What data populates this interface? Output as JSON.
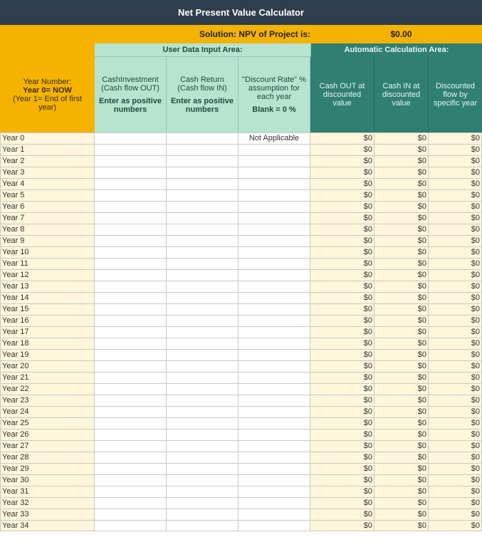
{
  "title": "Net Present Value Calculator",
  "solution": {
    "label": "Solution: NPV of Project is:",
    "value": "$0.00"
  },
  "section_labels": {
    "user": "User Data Input Area:",
    "auto": "Automatic Calculation Area:"
  },
  "headers": {
    "year": {
      "line1": "Year Number:",
      "line2": "Year 0= NOW",
      "line3": "(Year 1= End of first year)"
    },
    "user_cols": [
      {
        "title": "CashInvestment (Cash flow OUT)",
        "sub": "Enter as positive numbers"
      },
      {
        "title": "Cash Return (Cash flow IN)",
        "sub": "Enter as positive numbers"
      },
      {
        "title": "\"Discount Rate\" % assumption for each year",
        "sub": "Blank = 0 %"
      }
    ],
    "auto_cols": [
      "Cash OUT at discounted value",
      "Cash IN at discounted value",
      "Discounted flow by specific year"
    ]
  },
  "rows": [
    {
      "year": "Year 0",
      "inv": "",
      "ret": "",
      "rate": "Not Applicable",
      "out": "$0",
      "in": "$0",
      "flow": "$0"
    },
    {
      "year": "Year 1",
      "inv": "",
      "ret": "",
      "rate": "",
      "out": "$0",
      "in": "$0",
      "flow": "$0"
    },
    {
      "year": "Year 2",
      "inv": "",
      "ret": "",
      "rate": "",
      "out": "$0",
      "in": "$0",
      "flow": "$0"
    },
    {
      "year": "Year 3",
      "inv": "",
      "ret": "",
      "rate": "",
      "out": "$0",
      "in": "$0",
      "flow": "$0"
    },
    {
      "year": "Year 4",
      "inv": "",
      "ret": "",
      "rate": "",
      "out": "$0",
      "in": "$0",
      "flow": "$0"
    },
    {
      "year": "Year 5",
      "inv": "",
      "ret": "",
      "rate": "",
      "out": "$0",
      "in": "$0",
      "flow": "$0"
    },
    {
      "year": "Year 6",
      "inv": "",
      "ret": "",
      "rate": "",
      "out": "$0",
      "in": "$0",
      "flow": "$0"
    },
    {
      "year": "Year 7",
      "inv": "",
      "ret": "",
      "rate": "",
      "out": "$0",
      "in": "$0",
      "flow": "$0"
    },
    {
      "year": "Year 8",
      "inv": "",
      "ret": "",
      "rate": "",
      "out": "$0",
      "in": "$0",
      "flow": "$0"
    },
    {
      "year": "Year 9",
      "inv": "",
      "ret": "",
      "rate": "",
      "out": "$0",
      "in": "$0",
      "flow": "$0"
    },
    {
      "year": "Year 10",
      "inv": "",
      "ret": "",
      "rate": "",
      "out": "$0",
      "in": "$0",
      "flow": "$0"
    },
    {
      "year": "Year 11",
      "inv": "",
      "ret": "",
      "rate": "",
      "out": "$0",
      "in": "$0",
      "flow": "$0"
    },
    {
      "year": "Year 12",
      "inv": "",
      "ret": "",
      "rate": "",
      "out": "$0",
      "in": "$0",
      "flow": "$0"
    },
    {
      "year": "Year 13",
      "inv": "",
      "ret": "",
      "rate": "",
      "out": "$0",
      "in": "$0",
      "flow": "$0"
    },
    {
      "year": "Year 14",
      "inv": "",
      "ret": "",
      "rate": "",
      "out": "$0",
      "in": "$0",
      "flow": "$0"
    },
    {
      "year": "Year 15",
      "inv": "",
      "ret": "",
      "rate": "",
      "out": "$0",
      "in": "$0",
      "flow": "$0"
    },
    {
      "year": "Year 16",
      "inv": "",
      "ret": "",
      "rate": "",
      "out": "$0",
      "in": "$0",
      "flow": "$0"
    },
    {
      "year": "Year 17",
      "inv": "",
      "ret": "",
      "rate": "",
      "out": "$0",
      "in": "$0",
      "flow": "$0"
    },
    {
      "year": "Year 18",
      "inv": "",
      "ret": "",
      "rate": "",
      "out": "$0",
      "in": "$0",
      "flow": "$0"
    },
    {
      "year": "Year 19",
      "inv": "",
      "ret": "",
      "rate": "",
      "out": "$0",
      "in": "$0",
      "flow": "$0"
    },
    {
      "year": "Year 20",
      "inv": "",
      "ret": "",
      "rate": "",
      "out": "$0",
      "in": "$0",
      "flow": "$0"
    },
    {
      "year": "Year 21",
      "inv": "",
      "ret": "",
      "rate": "",
      "out": "$0",
      "in": "$0",
      "flow": "$0"
    },
    {
      "year": "Year 22",
      "inv": "",
      "ret": "",
      "rate": "",
      "out": "$0",
      "in": "$0",
      "flow": "$0"
    },
    {
      "year": "Year 23",
      "inv": "",
      "ret": "",
      "rate": "",
      "out": "$0",
      "in": "$0",
      "flow": "$0"
    },
    {
      "year": "Year 24",
      "inv": "",
      "ret": "",
      "rate": "",
      "out": "$0",
      "in": "$0",
      "flow": "$0"
    },
    {
      "year": "Year 25",
      "inv": "",
      "ret": "",
      "rate": "",
      "out": "$0",
      "in": "$0",
      "flow": "$0"
    },
    {
      "year": "Year 26",
      "inv": "",
      "ret": "",
      "rate": "",
      "out": "$0",
      "in": "$0",
      "flow": "$0"
    },
    {
      "year": "Year 27",
      "inv": "",
      "ret": "",
      "rate": "",
      "out": "$0",
      "in": "$0",
      "flow": "$0"
    },
    {
      "year": "Year 28",
      "inv": "",
      "ret": "",
      "rate": "",
      "out": "$0",
      "in": "$0",
      "flow": "$0"
    },
    {
      "year": "Year 29",
      "inv": "",
      "ret": "",
      "rate": "",
      "out": "$0",
      "in": "$0",
      "flow": "$0"
    },
    {
      "year": "Year 30",
      "inv": "",
      "ret": "",
      "rate": "",
      "out": "$0",
      "in": "$0",
      "flow": "$0"
    },
    {
      "year": "Year 31",
      "inv": "",
      "ret": "",
      "rate": "",
      "out": "$0",
      "in": "$0",
      "flow": "$0"
    },
    {
      "year": "Year 32",
      "inv": "",
      "ret": "",
      "rate": "",
      "out": "$0",
      "in": "$0",
      "flow": "$0"
    },
    {
      "year": "Year 33",
      "inv": "",
      "ret": "",
      "rate": "",
      "out": "$0",
      "in": "$0",
      "flow": "$0"
    },
    {
      "year": "Year 34",
      "inv": "",
      "ret": "",
      "rate": "",
      "out": "$0",
      "in": "$0",
      "flow": "$0"
    }
  ]
}
